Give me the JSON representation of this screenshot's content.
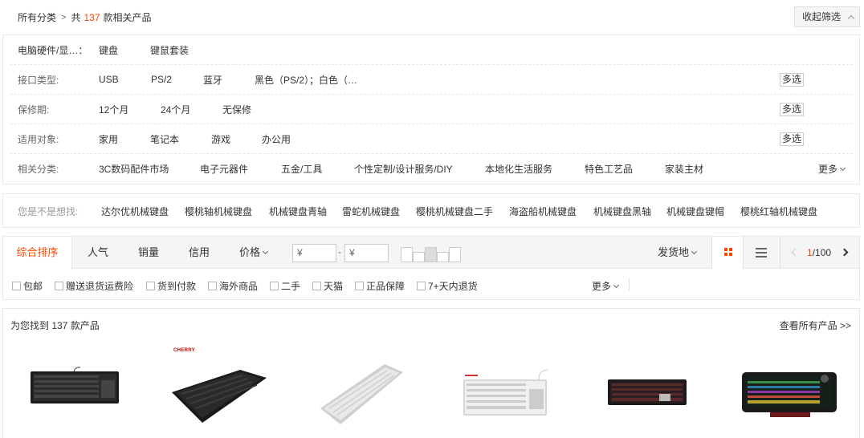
{
  "breadcrumb": {
    "root": "所有分类",
    "sep": ">",
    "prefix": "共",
    "count": "137",
    "suffix": "款相关产品"
  },
  "collapse_label": "收起筛选",
  "filters": [
    {
      "label": "电脑硬件/显…：",
      "options": [
        "键盘",
        "键鼠套装"
      ],
      "multi": "",
      "more": ""
    },
    {
      "label": "接口类型:",
      "options": [
        "USB",
        "PS/2",
        "蓝牙",
        "黑色（PS/2）；白色（…"
      ],
      "multi": "多选",
      "more": ""
    },
    {
      "label": "保修期:",
      "options": [
        "12个月",
        "24个月",
        "无保修"
      ],
      "multi": "多选",
      "more": ""
    },
    {
      "label": "适用对象:",
      "options": [
        "家用",
        "笔记本",
        "游戏",
        "办公用"
      ],
      "multi": "多选",
      "more": ""
    },
    {
      "label": "相关分类:",
      "options": [
        "3C数码配件市场",
        "电子元器件",
        "五金/工具",
        "个性定制/设计服务/DIY",
        "本地化生活服务",
        "特色工艺品",
        "家装主材"
      ],
      "multi": "",
      "more": "更多"
    }
  ],
  "suggest": {
    "label": "您是不是想找:",
    "items": [
      "达尔优机械键盘",
      "樱桃轴机械键盘",
      "机械键盘青轴",
      "雷蛇机械键盘",
      "樱桃机械键盘二手",
      "海盗船机械键盘",
      "机械键盘黑轴",
      "机械键盘键帽",
      "樱桃红轴机械键盘"
    ]
  },
  "sort": {
    "tabs": [
      "综合排序",
      "人气",
      "销量",
      "信用",
      "价格"
    ],
    "price_from": "¥",
    "price_to": "¥",
    "price_dash": "-",
    "ship_label": "发货地",
    "page_current": "1",
    "page_total": "/100"
  },
  "checkboxes": [
    "包邮",
    "赠送退货运费险",
    "货到付款",
    "海外商品",
    "二手",
    "天猫",
    "正品保障",
    "7+天内退货"
  ],
  "checks_more": "更多",
  "results": {
    "title": "为您找到 137 款产品",
    "view_all": "查看所有产品 >>"
  },
  "product_logo_text": "CHERRY",
  "colors": {
    "accent": "#ff4400",
    "border": "#e8e8e8",
    "bar_bg": "#f5f5f5"
  }
}
